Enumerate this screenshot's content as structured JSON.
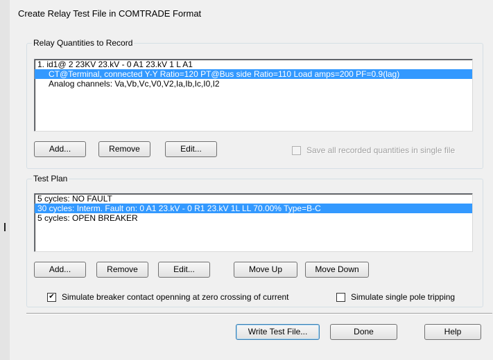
{
  "dialog": {
    "title": "Create Relay Test File in COMTRADE Format"
  },
  "relay_quantities": {
    "group_label": "Relay Quantities to Record",
    "items": [
      "1. id1@ 2 23KV 23.kV - 0 A1 23.kV 1 L A1",
      "CT@Terminal, connected Y-Y  Ratio=120  PT@Bus side  Ratio=110  Load amps=200 PF=0.9(lag)",
      "Analog channels: Va,Vb,Vc,V0,V2,Ia,Ib,Ic,I0,I2"
    ],
    "add_label": "Add...",
    "remove_label": "Remove",
    "edit_label": "Edit...",
    "save_single_label": "Save all recorded quantities in single file",
    "save_single_checked": false
  },
  "test_plan": {
    "group_label": "Test Plan",
    "items": [
      "5 cycles: NO FAULT",
      "30 cycles: Interm. Fault on: 0 A1 23.kV - 0 R1 23.kV 1L LL 70.00% Type=B-C",
      "5 cycles: OPEN BREAKER"
    ],
    "add_label": "Add...",
    "remove_label": "Remove",
    "edit_label": "Edit...",
    "move_up_label": "Move Up",
    "move_down_label": "Move Down",
    "simulate_zero_crossing_label": "Simulate breaker contact openning at zero crossing of current",
    "simulate_zero_crossing_checked": true,
    "check_mark": "✔",
    "simulate_single_pole_label": "Simulate single pole tripping",
    "simulate_single_pole_checked": false
  },
  "footer": {
    "write_label": "Write Test File...",
    "done_label": "Done",
    "help_label": "Help"
  }
}
